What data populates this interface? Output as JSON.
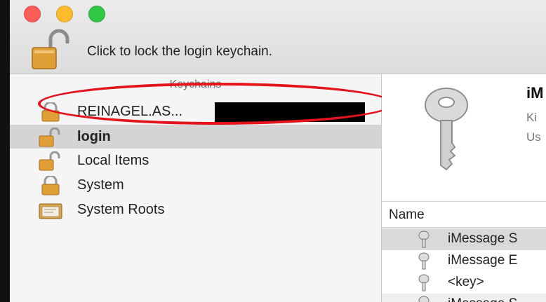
{
  "toolbar": {
    "lock_text": "Click to lock the login keychain."
  },
  "sidebar": {
    "header": "Keychains",
    "items": [
      {
        "label": "REINAGEL.AS...",
        "icon": "lock-icon"
      },
      {
        "label": "login",
        "icon": "unlocked-lock-icon",
        "selected": true
      },
      {
        "label": "Local Items",
        "icon": "unlocked-lock-icon"
      },
      {
        "label": "System",
        "icon": "lock-icon"
      },
      {
        "label": "System Roots",
        "icon": "certificate-folder-icon"
      }
    ]
  },
  "detail": {
    "title": "iM",
    "kind": "Ki",
    "use": "Us"
  },
  "table": {
    "column_name": "Name",
    "rows": [
      "iMessage S",
      "iMessage E",
      "<key>",
      "iMessage S"
    ]
  },
  "colors": {
    "annotation": "#e3141c",
    "selection": "#d4d4d4",
    "titlebar": "#e6e6e6"
  }
}
